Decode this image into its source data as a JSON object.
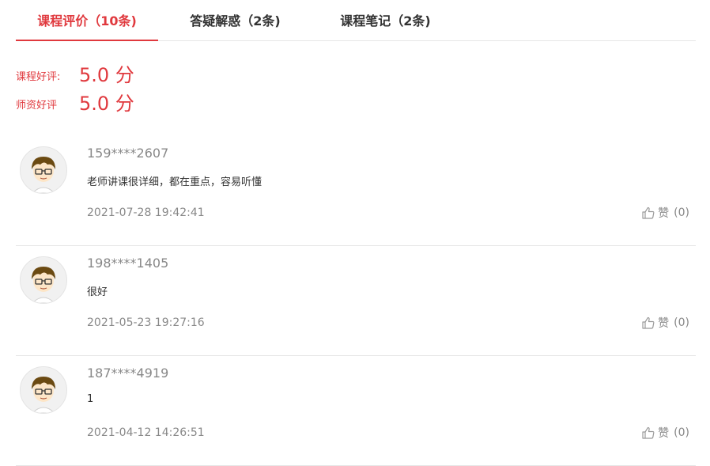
{
  "tabs": [
    {
      "label": "课程评价（10条)"
    },
    {
      "label": "答疑解惑（2条)"
    },
    {
      "label": "课程笔记（2条)"
    }
  ],
  "ratings": {
    "course_label": "课程好评:",
    "course_score": "5.0 分",
    "teacher_label": "师资好评",
    "teacher_score": "5.0 分"
  },
  "comments": [
    {
      "user": "159****2607",
      "text": "老师讲课很详细，都在重点，容易听懂",
      "time": "2021-07-28 19:42:41",
      "like_label": "赞",
      "like_count": "(0)"
    },
    {
      "user": "198****1405",
      "text": "很好",
      "time": "2021-05-23 19:27:16",
      "like_label": "赞",
      "like_count": "(0)"
    },
    {
      "user": "187****4919",
      "text": "1",
      "time": "2021-04-12 14:26:51",
      "like_label": "赞",
      "like_count": "(0)"
    }
  ],
  "colors": {
    "accent": "#e0393e",
    "muted": "#888888",
    "divider": "#e6e6e6"
  },
  "icons": {
    "avatar": "cartoon-avatar-icon",
    "like": "thumbs-up-icon"
  }
}
